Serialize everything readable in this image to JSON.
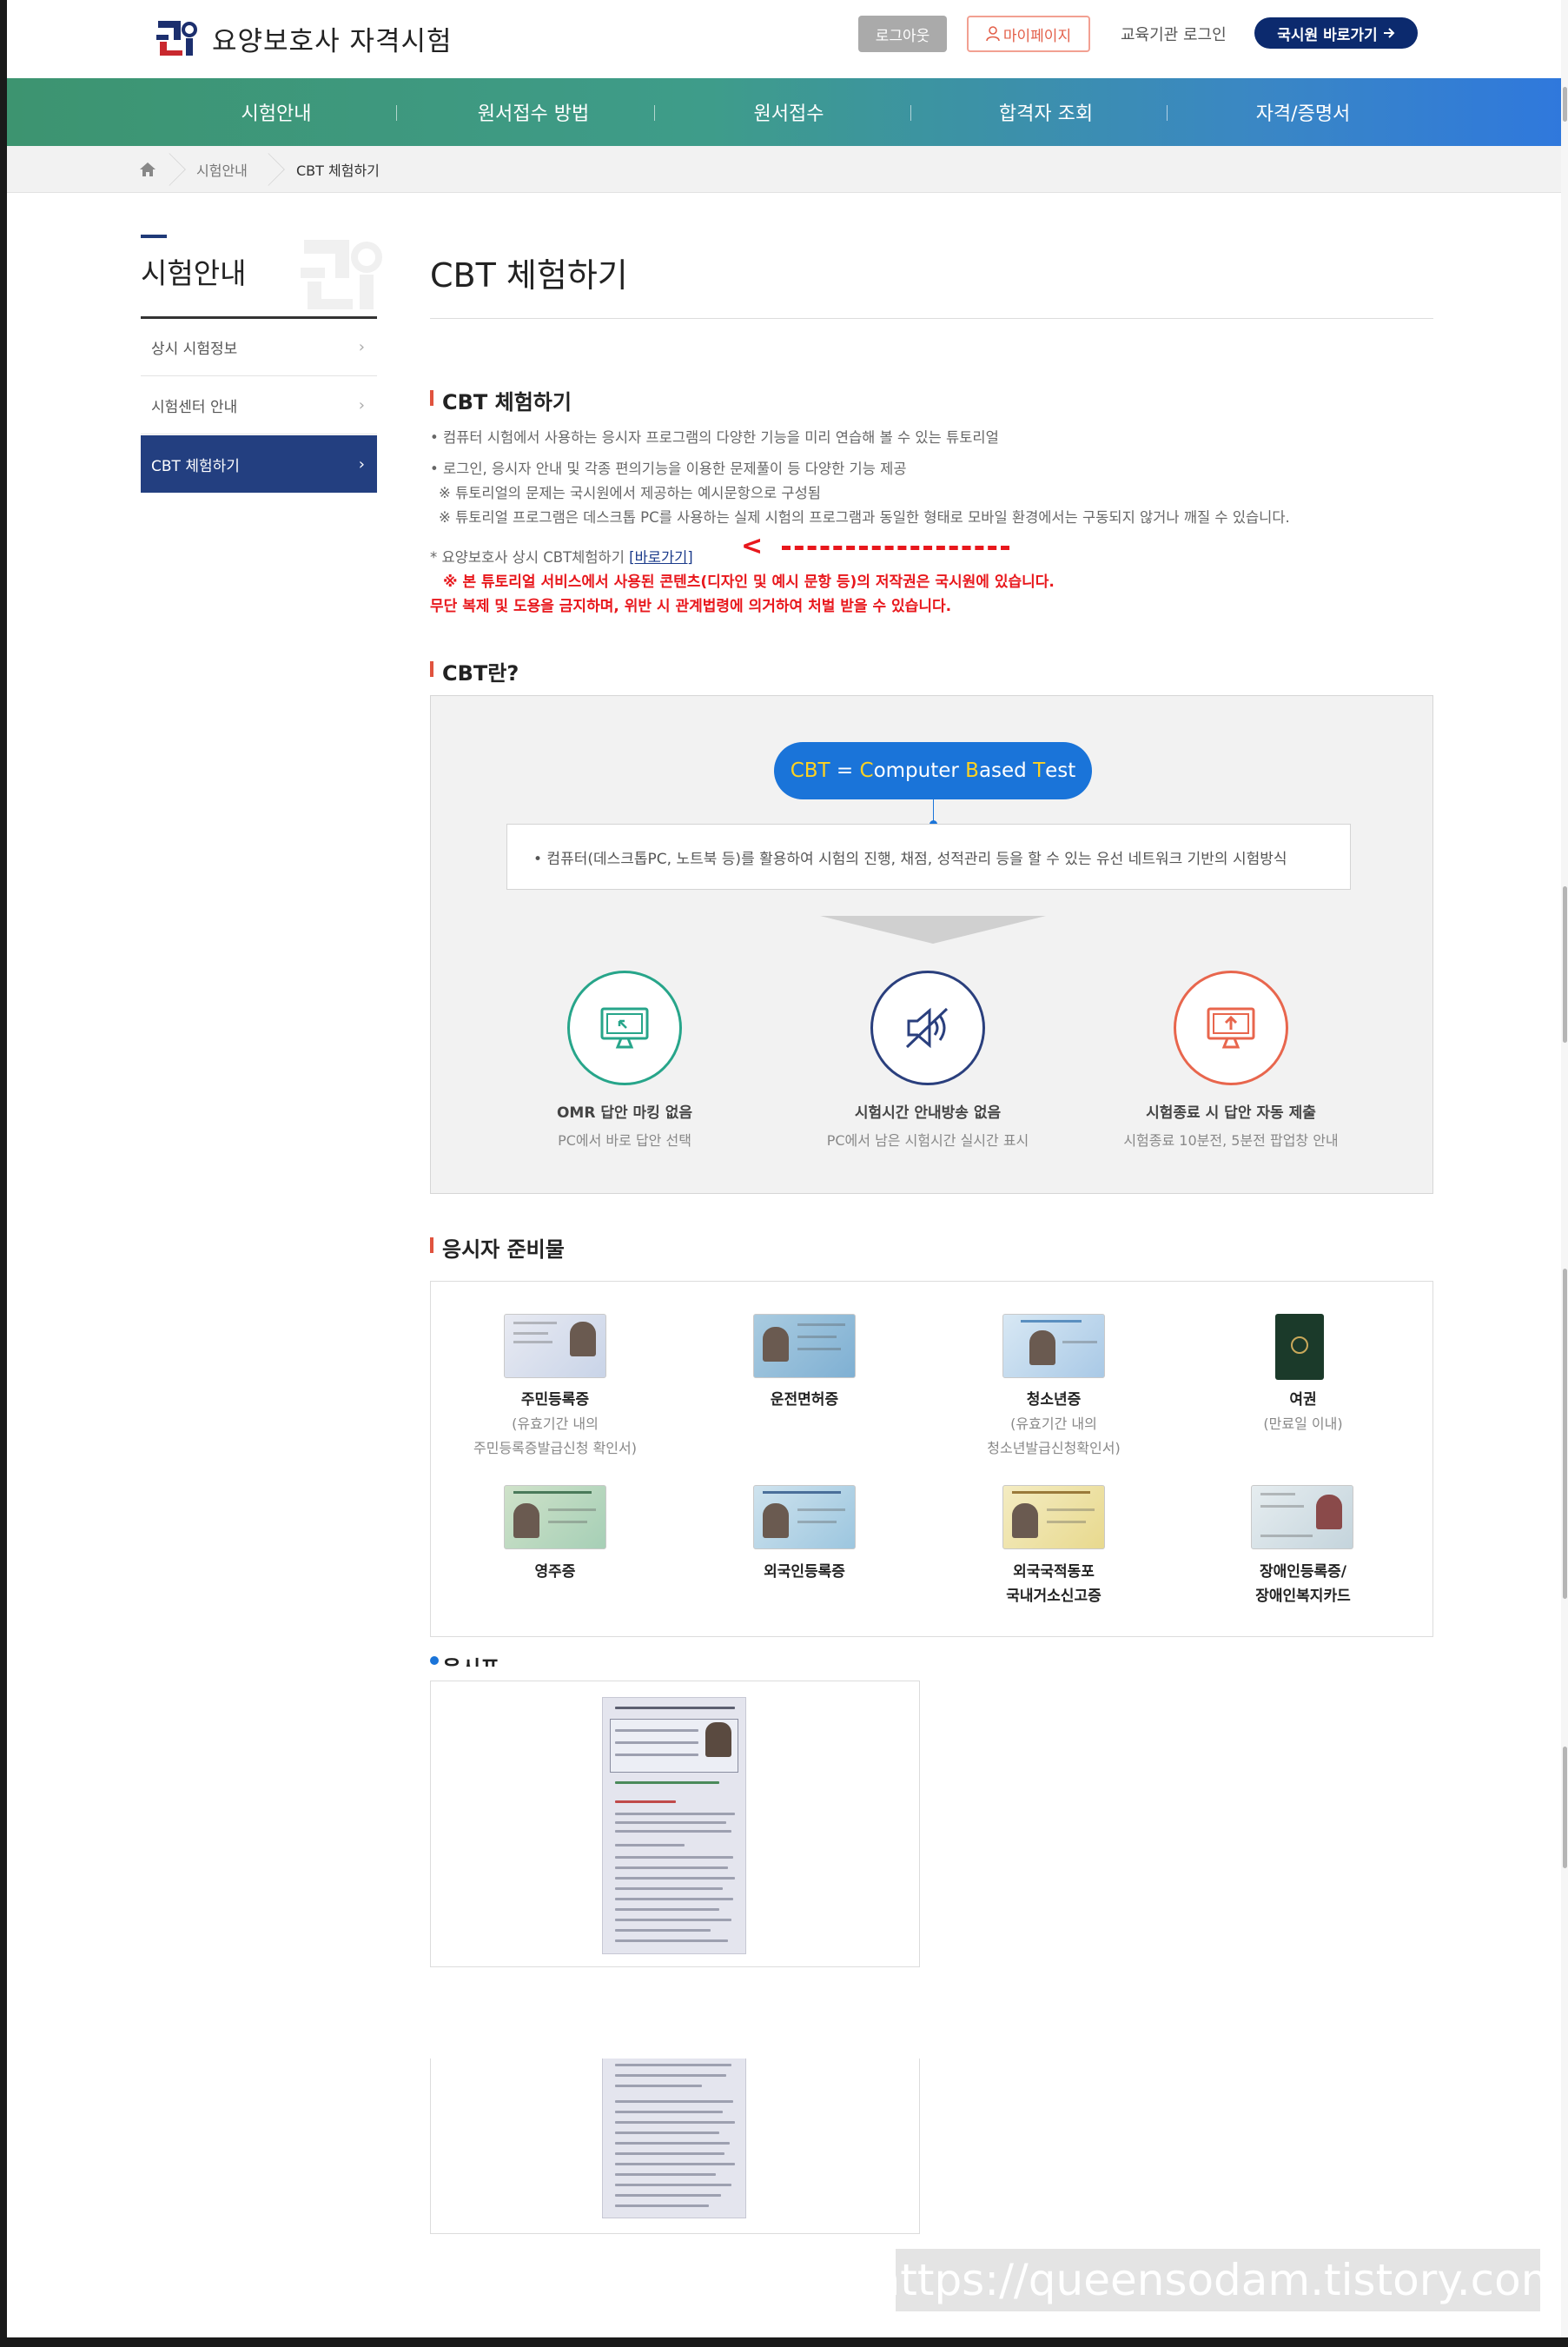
{
  "header": {
    "logo_text": "요양보호사 자격시험",
    "logout_label": "로그아웃",
    "mypage_label": "마이페이지",
    "edu_login_label": "교육기관 로그인",
    "shortcut_label": "국시원 바로가기"
  },
  "nav": {
    "items": [
      {
        "label": "시험안내"
      },
      {
        "label": "원서접수 방법"
      },
      {
        "label": "원서접수"
      },
      {
        "label": "합격자 조회"
      },
      {
        "label": "자격/증명서"
      }
    ]
  },
  "breadcrumb": {
    "items": [
      {
        "label": "시험안내"
      },
      {
        "label": "CBT 체험하기"
      }
    ]
  },
  "sidebar": {
    "title": "시험안내",
    "items": [
      {
        "label": "상시 시험정보",
        "active": false
      },
      {
        "label": "시험센터 안내",
        "active": false
      },
      {
        "label": "CBT 체험하기",
        "active": true
      }
    ]
  },
  "main": {
    "page_title": "CBT 체험하기",
    "section1": {
      "heading": "CBT 체험하기",
      "lines": [
        "• 컴퓨터 시험에서 사용하는 응시자 프로그램의 다양한 기능을 미리 연습해 볼 수 있는 튜토리얼",
        "• 로그인, 응시자 안내 및 각종 편의기능을 이용한 문제풀이 등 다양한 기능 제공",
        "※ 튜토리얼의 문제는 국시원에서 제공하는 예시문항으로 구성됨",
        "※ 튜토리얼 프로그램은 데스크톱 PC를 사용하는 실제 시험의 프로그램과 동일한 형태로 모바일 환경에서는 구동되지 않거나 깨질 수 있습니다."
      ],
      "link_prefix": "* 요양보호사 상시 CBT체험하기 ",
      "link_label": "[바로가기]",
      "warning1": "※ 본 튜토리얼 서비스에서 사용된 콘텐츠(디자인 및 예시 문항 등)의 저작권은 국시원에 있습니다.",
      "warning2": "무단 복제 및 도용을 금지하며, 위반 시 관계법령에 의거하여 처벌 받을 수 있습니다."
    },
    "section2": {
      "heading": "CBT란?",
      "pill": {
        "c1": "CBT",
        "eq": " = ",
        "w1a": "C",
        "w1b": "omputer ",
        "w2a": "B",
        "w2b": "ased ",
        "w3a": "T",
        "w3b": "est"
      },
      "definition": "• 컴퓨터(데스크톱PC, 노트북 등)를 활용하여 시험의 진행, 채점, 성적관리 등을 할 수 있는 유선 네트워크 기반의 시험방식",
      "features": [
        {
          "title": "OMR 답안 마킹 없음",
          "sub": "PC에서 바로 답안 선택",
          "color": "#27a58a",
          "icon": "monitor-cursor-icon"
        },
        {
          "title": "시험시간 안내방송 없음",
          "sub": "PC에서 남은 시험시간 실시간 표시",
          "color": "#2a3f7d",
          "icon": "speaker-mute-icon"
        },
        {
          "title": "시험종료 시 답안 자동 제출",
          "sub": "시험종료 10분전, 5분전 팝업창 안내",
          "color": "#e8664d",
          "icon": "monitor-upload-icon"
        }
      ]
    },
    "section3": {
      "heading": "응시자 준비물",
      "ids": [
        {
          "name": "주민등록증",
          "sub1": "(유효기간 내의",
          "sub2": "주민등록증발급신청 확인서)"
        },
        {
          "name": "운전면허증",
          "sub1": "",
          "sub2": ""
        },
        {
          "name": "청소년증",
          "sub1": "(유효기간 내의",
          "sub2": "청소년발급신청확인서)"
        },
        {
          "name": "여권",
          "sub1": "(만료일 이내)",
          "sub2": ""
        },
        {
          "name": "영주증",
          "sub1": "",
          "sub2": ""
        },
        {
          "name": "외국인등록증",
          "sub1": "",
          "sub2": ""
        },
        {
          "name": "외국국적동포",
          "sub1": "국내거소신고증",
          "sub2": ""
        },
        {
          "name": "장애인등록증/",
          "sub1": "장애인복지카드",
          "sub2": ""
        }
      ]
    },
    "section4": {
      "heading": "응시표"
    }
  },
  "watermark": "https://queensodam.tistory.com",
  "colors": {
    "nav_start": "#3d9470",
    "nav_end": "#2f78dd",
    "sidebar_active": "#233f80",
    "accent_blue": "#1a74d9",
    "warning_red": "#e8171c"
  }
}
